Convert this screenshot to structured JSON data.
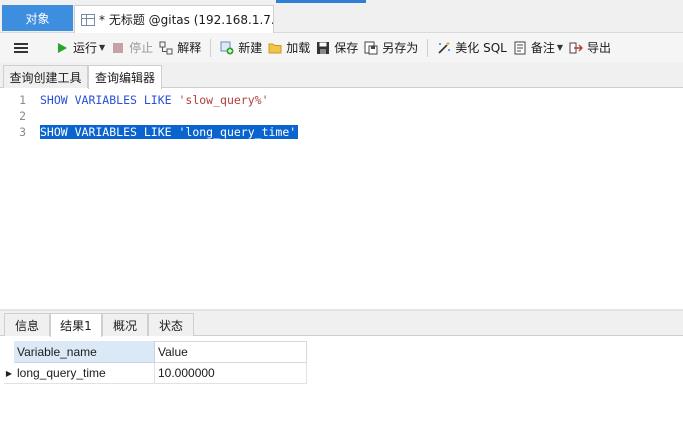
{
  "tabs": {
    "objects_label": "对象",
    "query_tab_label": "* 无标题 @gitas (192.168.1.7..."
  },
  "toolbar": {
    "run_label": "运行",
    "stop_label": "停止",
    "explain_label": "解释",
    "new_label": "新建",
    "load_label": "加载",
    "save_label": "保存",
    "save_as_label": "另存为",
    "beautify_label": "美化 SQL",
    "comment_label": "备注",
    "export_label": "导出"
  },
  "subtabs": {
    "query_builder": "查询创建工具",
    "query_editor": "查询编辑器"
  },
  "editor": {
    "lines": [
      {
        "number": "1",
        "keyword": "SHOW VARIABLES LIKE ",
        "string": "'slow_query%'"
      },
      {
        "number": "2",
        "keyword": "",
        "string": ""
      },
      {
        "number": "3",
        "keyword": "SHOW VARIABLES LIKE ",
        "string": "'long_query_time'"
      }
    ],
    "selected_line": 3
  },
  "result_tabs": {
    "info": "信息",
    "result1": "结果1",
    "overview": "概况",
    "status": "状态"
  },
  "result_grid": {
    "columns": [
      "Variable_name",
      "Value"
    ],
    "rows": [
      [
        "long_query_time",
        "10.000000"
      ]
    ]
  },
  "colors": {
    "objects_tab_bg": "#3e8ee0",
    "selection_bg": "#0a64cf",
    "keyword": "#2a4fd8",
    "string": "#b0403a",
    "grid_header_bg": "#dbe8f6"
  }
}
